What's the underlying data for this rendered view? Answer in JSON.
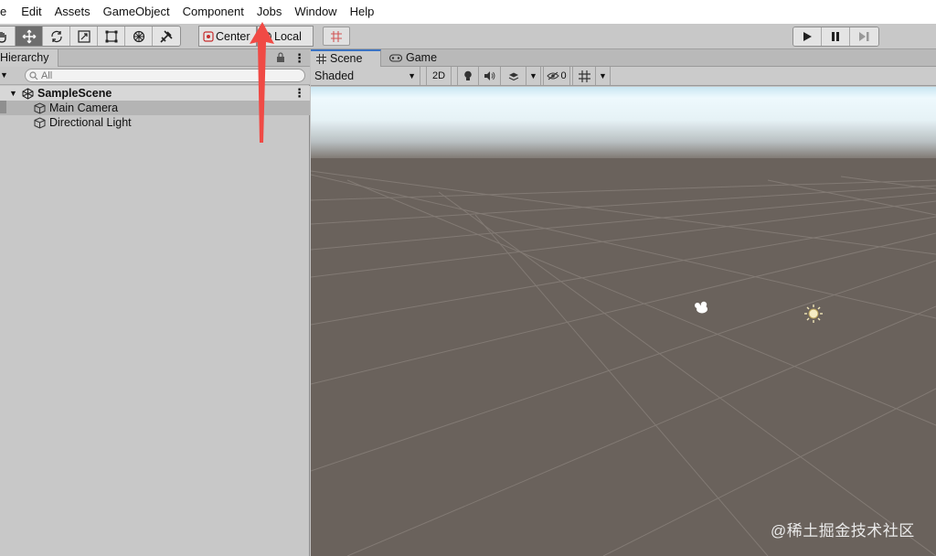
{
  "menu": {
    "items": [
      "e",
      "Edit",
      "Assets",
      "GameObject",
      "Component",
      "Jobs",
      "Window",
      "Help"
    ]
  },
  "toolbar": {
    "tools": [
      "hand-tool",
      "move-tool",
      "rotate-tool",
      "scale-tool",
      "rect-tool",
      "transform-tool",
      "custom-tool"
    ],
    "active_tool": "move-tool",
    "pivot_label": "Center",
    "space_label": "Local"
  },
  "hierarchy": {
    "tab_label": "Hierarchy",
    "search_placeholder": "All",
    "scene_name": "SampleScene",
    "objects": [
      "Main Camera",
      "Directional Light"
    ]
  },
  "scene_view": {
    "tabs": [
      "Scene",
      "Game"
    ],
    "shading_mode": "Shaded",
    "mode_2d_label": "2D",
    "hidden_count": "0"
  },
  "watermark": "@稀土掘金技术社区",
  "colors": {
    "accent": "#3a72c4",
    "annotation_arrow": "#f04a45",
    "ground": "#6a625c",
    "sky_top": "#ddf0fb"
  }
}
